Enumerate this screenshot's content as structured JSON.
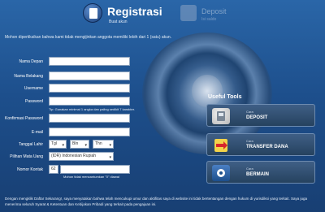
{
  "header": {
    "register_tab": {
      "title": "Registrasi",
      "subtitle": "Buat akun"
    },
    "deposit_tab": {
      "title": "Deposit",
      "subtitle": "Isi saldo"
    }
  },
  "intro": "Mohon dipertiksikan bahwa kami tidak mengijinkan anggota memiliki lebih dari 1 (satu) akun.",
  "form": {
    "nama_depan": {
      "label": "Nama Depan",
      "value": ""
    },
    "nama_belakang": {
      "label": "Nama Belakang",
      "value": ""
    },
    "username": {
      "label": "Username",
      "value": ""
    },
    "password": {
      "label": "Password",
      "value": "",
      "tip": "Tip: Gunakan minimal 1 angka dan paling sedikit 7 karakter."
    },
    "konfirmasi_password": {
      "label": "Konfirmasi Password",
      "value": ""
    },
    "email": {
      "label": "E-mail",
      "value": ""
    },
    "tanggal_lahir": {
      "label": "Tanggal Lahir",
      "day": "Tgl",
      "month": "Bln",
      "year": "Thn"
    },
    "mata_uang": {
      "label": "Pilihan Mata Uang",
      "value": "(IDR) Indonesian Rupiah"
    },
    "nomor_kontak": {
      "label": "Nomor Kontak",
      "prefix": "62",
      "tip": "Mohon tidak mencantumkan \"0\" diawal"
    }
  },
  "tools": {
    "title": "Useful Tools",
    "items": [
      {
        "small": "Cara",
        "big": "DEPOSIT"
      },
      {
        "small": "Cara",
        "big": "TRANSFER DANA"
      },
      {
        "small": "Cara",
        "big": "BERMAIN"
      }
    ]
  },
  "footer": "Dengan mengklik Daftar Sekarang!, saya menyatakan bahwa telah mencukupi umur dan aktifitas saya di website ini tidak bertentangan dengan hukum di yurisdiksi yang terkait. Saya juga menerima seluruh Syarat & Ketentuan dan Kebijakan Pribadi yang terkait pada pengajuan ini."
}
